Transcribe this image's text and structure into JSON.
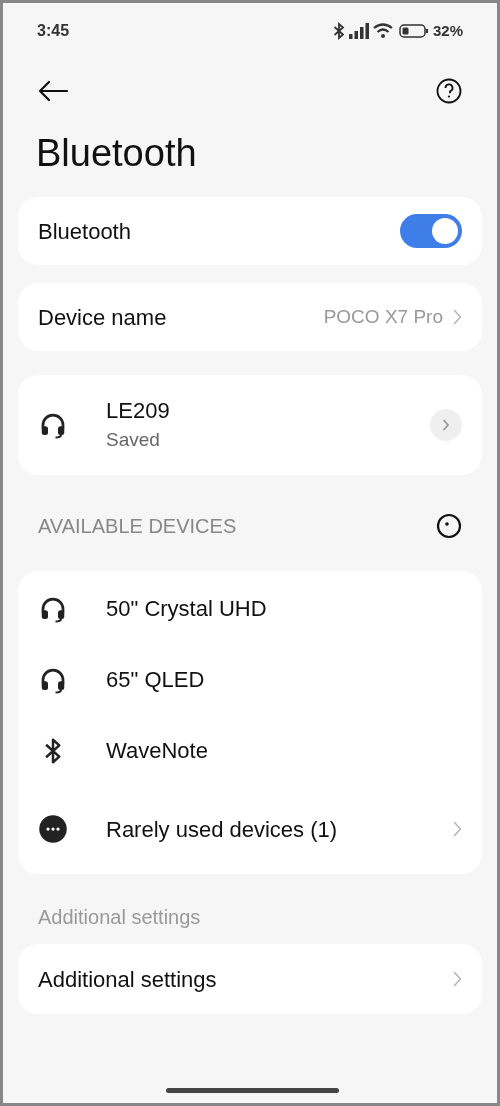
{
  "status_bar": {
    "time": "3:45",
    "battery": "32%"
  },
  "title": "Bluetooth",
  "bluetooth_toggle": {
    "label": "Bluetooth",
    "on": true
  },
  "device_name": {
    "label": "Device name",
    "value": "POCO X7 Pro"
  },
  "saved_devices": [
    {
      "name": "LE209",
      "status": "Saved",
      "kind": "headphones"
    }
  ],
  "available_devices": {
    "header": "AVAILABLE DEVICES",
    "items": [
      {
        "name": "50\" Crystal UHD",
        "kind": "headphones"
      },
      {
        "name": "65\" QLED",
        "kind": "headphones"
      },
      {
        "name": "WaveNote",
        "kind": "bluetooth"
      },
      {
        "name": "Rarely used devices (1)",
        "kind": "more"
      }
    ]
  },
  "additional": {
    "header": "Additional settings",
    "item": "Additional settings"
  }
}
